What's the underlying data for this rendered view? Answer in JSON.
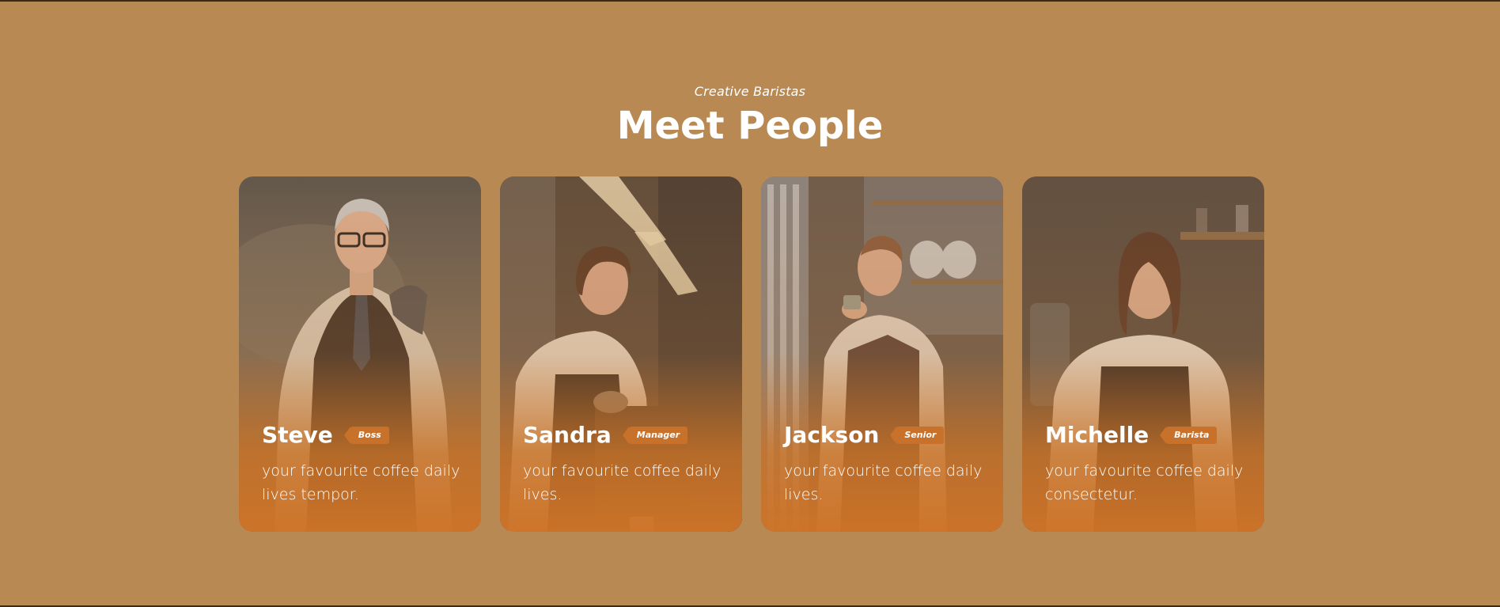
{
  "header": {
    "subtitle": "Creative Baristas",
    "title": "Meet People"
  },
  "colors": {
    "background": "#b98953",
    "badge": "#c8712b",
    "text": "#ffffff"
  },
  "team": [
    {
      "name": "Steve",
      "role": "Boss",
      "description": "your favourite coffee daily lives tempor."
    },
    {
      "name": "Sandra",
      "role": "Manager",
      "description": "your favourite coffee daily lives."
    },
    {
      "name": "Jackson",
      "role": "Senior",
      "description": "your favourite coffee daily lives."
    },
    {
      "name": "Michelle",
      "role": "Barista",
      "description": "your favourite coffee daily consectetur."
    }
  ]
}
